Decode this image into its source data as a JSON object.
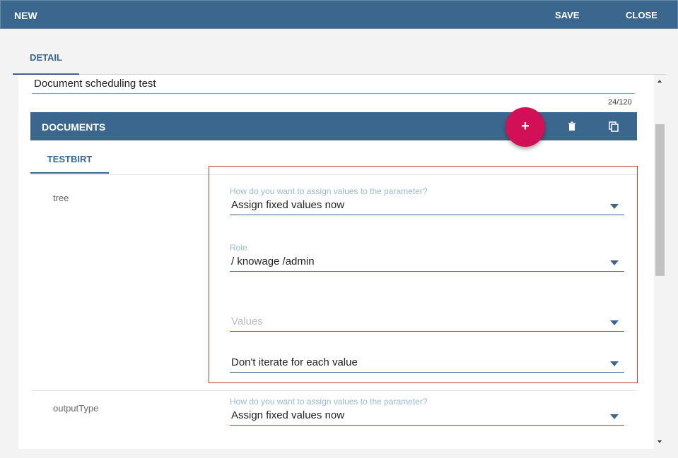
{
  "window": {
    "title": "NEW",
    "save_label": "SAVE",
    "close_label": "CLOSE"
  },
  "tabs": [
    {
      "label": "DETAIL",
      "active": true
    }
  ],
  "detail": {
    "name_value": "Document scheduling test",
    "char_counter": "24/120"
  },
  "documents": {
    "header_label": "DOCUMENTS",
    "add_button_label": "+",
    "icons": {
      "add": "add-icon",
      "delete": "trash-icon",
      "copy": "copy-icon"
    },
    "subtab_label": "TESTBIRT"
  },
  "parameters": [
    {
      "name": "tree",
      "assign_label": "How do you want to assign values to the parameter?",
      "assign_value": "Assign fixed values now",
      "role_label": "Role",
      "role_value": "/ knowage /admin",
      "values_placeholder": "Values",
      "iterate_value": "Don't iterate for each value"
    },
    {
      "name": "outputType",
      "assign_label": "How do you want to assign values to the parameter?",
      "assign_value": "Assign fixed values now"
    }
  ],
  "colors": {
    "primary": "#3b678f",
    "accent": "#d21057",
    "highlight_border": "#c0392b"
  }
}
